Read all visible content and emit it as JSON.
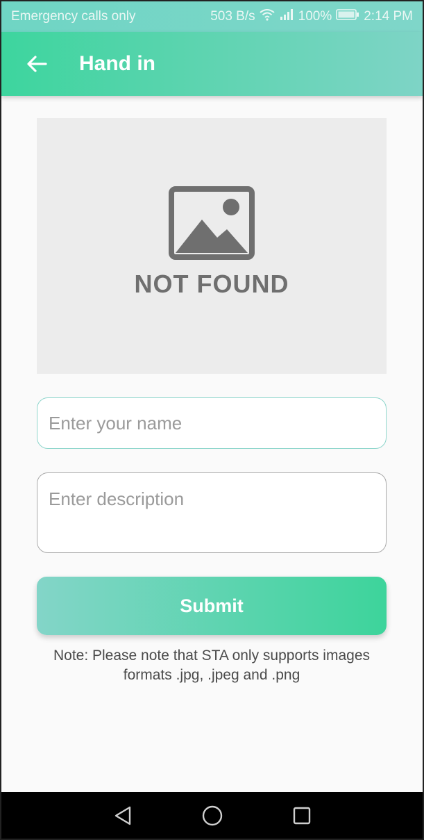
{
  "status_bar": {
    "carrier": "Emergency calls only",
    "speed": "503 B/s",
    "battery": "100%",
    "time": "2:14 PM"
  },
  "app_bar": {
    "title": "Hand in"
  },
  "image_placeholder": {
    "text": "NOT FOUND"
  },
  "form": {
    "name_placeholder": "Enter your name",
    "description_placeholder": "Enter description",
    "submit_label": "Submit"
  },
  "note": "Note: Please note that STA only supports images formats .jpg, .jpeg and .png",
  "icons": {
    "back": "arrow-left-icon",
    "image": "image-icon",
    "wifi": "wifi-icon",
    "signal": "signal-icon",
    "battery": "battery-icon",
    "nav_back": "triangle-back-icon",
    "nav_home": "circle-home-icon",
    "nav_recent": "square-recent-icon"
  },
  "colors": {
    "accent_start": "#3dd59e",
    "accent_end": "#7ed4c6"
  }
}
